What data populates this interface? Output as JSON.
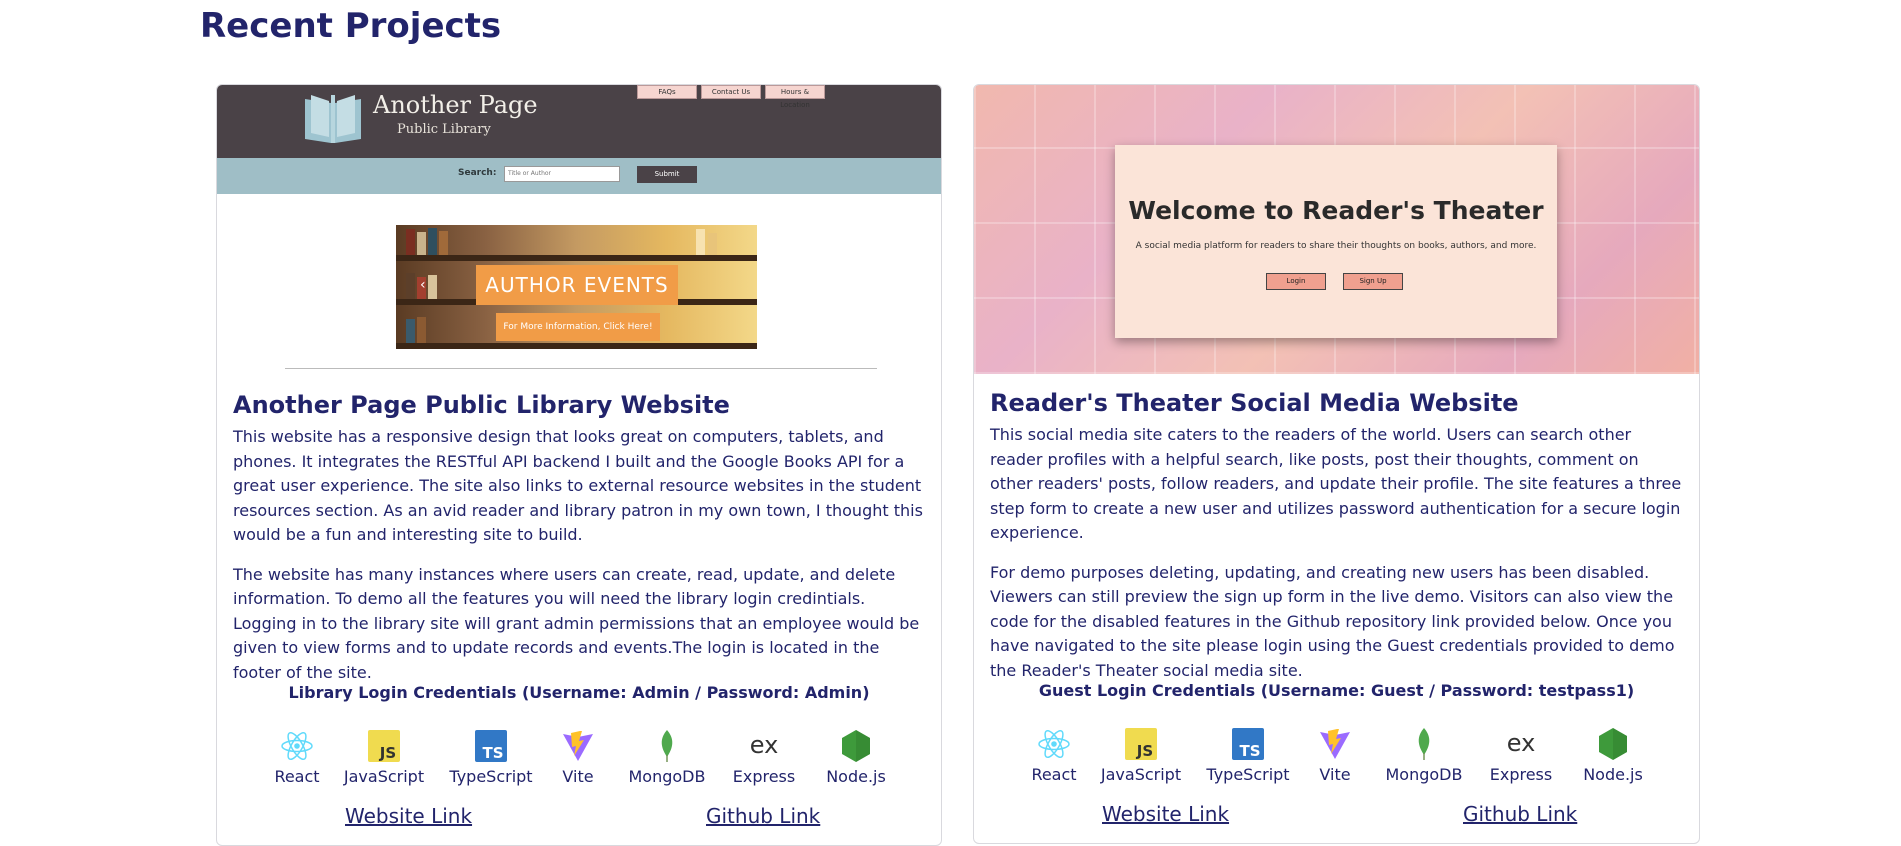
{
  "page": {
    "title": "Recent Projects"
  },
  "projects": [
    {
      "preview": {
        "site_name": "Another Page",
        "site_subtitle": "Public Library",
        "nav_tabs": [
          "FAQs",
          "Contact Us",
          "Hours & Location"
        ],
        "search_label": "Search:",
        "search_placeholder": "Title or Author",
        "submit_label": "Submit",
        "banner_title": "AUTHOR EVENTS",
        "banner_subtitle": "For More Information, Click Here!",
        "banner_arrow": "‹"
      },
      "title": "Another Page Public Library Website",
      "paragraphs": [
        "This website has a responsive design that looks great on computers, tablets, and phones. It integrates the RESTful API backend I built and the Google Books API for a great user experience. The site also links to external resource websites in the student resources section. As an avid reader and library patron in my own town, I thought this would be a fun and interesting site to build.",
        "The website has many instances where users can create, read, update, and delete information. To demo all the features you will need the library login credintials. Logging in to the library site will grant admin permissions that an employee would be given to view forms and to update records and events.The login is located in the footer of the site."
      ],
      "credentials": "Library Login Credentials (Username: Admin / Password: Admin)",
      "tech": [
        {
          "label": "React",
          "icon": "react-icon"
        },
        {
          "label": "JavaScript",
          "icon": "javascript-icon"
        },
        {
          "label": "TypeScript",
          "icon": "typescript-icon"
        },
        {
          "label": "Vite",
          "icon": "vite-icon"
        },
        {
          "label": "MongoDB",
          "icon": "mongodb-icon"
        },
        {
          "label": "Express",
          "icon": "express-icon"
        },
        {
          "label": "Node.js",
          "icon": "nodejs-icon"
        }
      ],
      "website_link": "Website Link",
      "github_link": "Github Link"
    },
    {
      "preview": {
        "heading": "Welcome to Reader's Theater",
        "description": "A social media platform for readers to share their thoughts on books, authors, and more.",
        "login_label": "Login",
        "signup_label": "Sign Up"
      },
      "title": "Reader's Theater Social Media Website",
      "paragraphs": [
        "This social media site caters to the readers of the world. Users can search other reader profiles with a helpful search, like posts, post their thoughts, comment on other readers' posts, follow readers, and update their profile. The site features a three step form to create a new user and utilizes password authentication for a secure login experience.",
        "For demo purposes deleting, updating, and creating new users has been disabled. Viewers can still preview the sign up form in the live demo. Visitors can also view the code for the disabled features in the Github repository link provided below. Once you have navigated to the site please login using the Guest credentials provided to demo the Reader's Theater social media site."
      ],
      "credentials": "Guest Login Credentials (Username: Guest / Password: testpass1)",
      "tech": [
        {
          "label": "React",
          "icon": "react-icon"
        },
        {
          "label": "JavaScript",
          "icon": "javascript-icon"
        },
        {
          "label": "TypeScript",
          "icon": "typescript-icon"
        },
        {
          "label": "Vite",
          "icon": "vite-icon"
        },
        {
          "label": "MongoDB",
          "icon": "mongodb-icon"
        },
        {
          "label": "Express",
          "icon": "express-icon"
        },
        {
          "label": "Node.js",
          "icon": "nodejs-icon"
        }
      ],
      "website_link": "Website Link",
      "github_link": "Github Link"
    }
  ],
  "tech_icon_text": {
    "javascript": "JS",
    "typescript": "TS",
    "express": "ex"
  },
  "colors": {
    "heading": "#22246b",
    "react": "#61dafb",
    "javascript": "#f0db4f",
    "typescript": "#3178c6",
    "mongodb": "#4fa94d",
    "nodejs": "#3e9a3b",
    "vite_purple": "#9b6bff",
    "vite_yellow": "#ffc22a"
  }
}
